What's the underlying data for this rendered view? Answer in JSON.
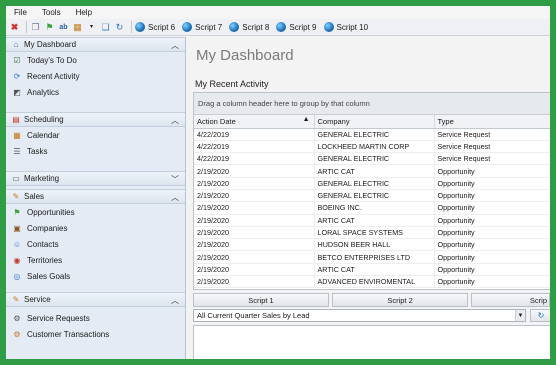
{
  "menu": [
    "File",
    "Tools",
    "Help"
  ],
  "toolbar": {
    "icons": [
      "delete-icon",
      "copy-icon",
      "flag-icon",
      "spellcheck-icon",
      "calendar-icon",
      "copy-pages-icon",
      "refresh-icon"
    ],
    "scripts": [
      "Script 6",
      "Script 7",
      "Script 8",
      "Script 9",
      "Script 10"
    ]
  },
  "sidebar": {
    "sections": [
      {
        "title": "My Dashboard",
        "items": [
          "Today's To Do",
          "Recent Activity",
          "Analytics"
        ]
      },
      {
        "title": "Scheduling",
        "items": [
          "Calendar",
          "Tasks"
        ]
      },
      {
        "title": "Marketing",
        "items": []
      },
      {
        "title": "Sales",
        "items": [
          "Opportunities",
          "Companies",
          "Contacts",
          "Territories",
          "Sales Goals"
        ]
      },
      {
        "title": "Service",
        "items": [
          "Service Requests",
          "Customer Transactions"
        ]
      }
    ]
  },
  "main": {
    "title": "My Dashboard",
    "activity_label": "My Recent Activity",
    "group_hint": "Drag a column header here to group by that column",
    "columns": [
      "Action Date",
      "Company",
      "Type"
    ],
    "rows": [
      [
        "4/22/2019",
        "GENERAL ELECTRIC",
        "Service Request"
      ],
      [
        "4/22/2019",
        "LOCKHEED MARTIN CORP",
        "Service Request"
      ],
      [
        "4/22/2019",
        "GENERAL ELECTRIC",
        "Service Request"
      ],
      [
        "2/19/2020",
        "ARTIC CAT",
        "Opportunity"
      ],
      [
        "2/19/2020",
        "GENERAL ELECTRIC",
        "Opportunity"
      ],
      [
        "2/19/2020",
        "GENERAL ELECTRIC",
        "Opportunity"
      ],
      [
        "2/19/2020",
        "BOEING INC.",
        "Opportunity"
      ],
      [
        "2/19/2020",
        "ARTIC CAT",
        "Opportunity"
      ],
      [
        "2/19/2020",
        "LORAL SPACE SYSTEMS",
        "Opportunity"
      ],
      [
        "2/19/2020",
        "HUDSON BEER HALL",
        "Opportunity"
      ],
      [
        "2/19/2020",
        "BETCO ENTERPRISES LTD",
        "Opportunity"
      ],
      [
        "2/19/2020",
        "ARTIC CAT",
        "Opportunity"
      ],
      [
        "2/19/2020",
        "ADVANCED ENVIROMENTAL",
        "Opportunity"
      ]
    ],
    "script_buttons": [
      "Script 1",
      "Script 2",
      "Scrip"
    ],
    "report_select": "All Current Quarter Sales by Lead"
  }
}
